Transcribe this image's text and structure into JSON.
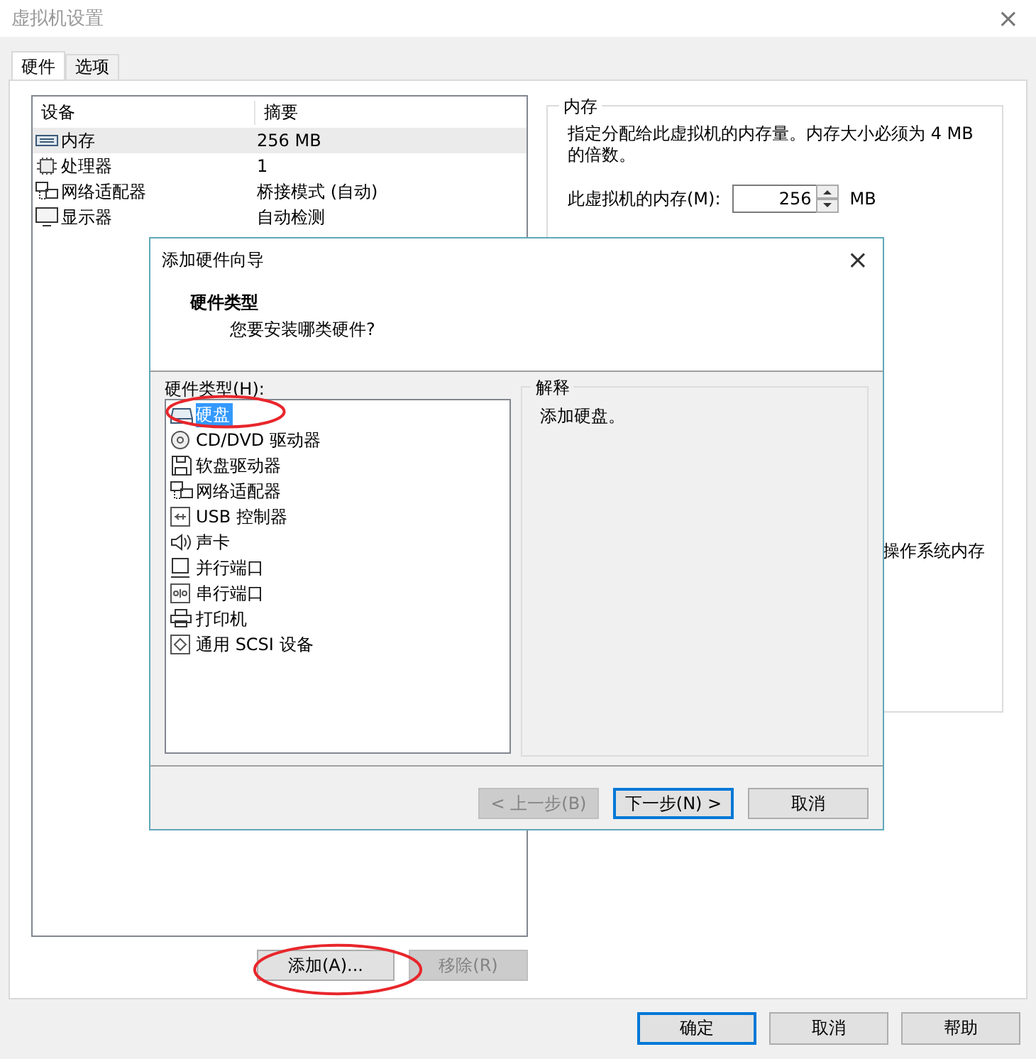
{
  "window": {
    "title": "虚拟机设置",
    "close": "×"
  },
  "tabs": [
    {
      "label": "硬件",
      "selected": true
    },
    {
      "label": "选项",
      "selected": false
    }
  ],
  "devices": {
    "columns": [
      "设备",
      "摘要"
    ],
    "rows": [
      {
        "kind": "memory",
        "name": "内存",
        "summary": "256 MB",
        "selected": true
      },
      {
        "kind": "cpu",
        "name": "处理器",
        "summary": "1",
        "selected": false
      },
      {
        "kind": "network",
        "name": "网络适配器",
        "summary": "桥接模式 (自动)",
        "selected": false
      },
      {
        "kind": "display",
        "name": "显示器",
        "summary": "自动检测",
        "selected": false
      }
    ]
  },
  "memory_panel": {
    "title": "内存",
    "description": "指定分配给此虚拟机的内存量。内存大小必须为 4 MB 的倍数。",
    "field_label": "此虚拟机的内存(M):",
    "value": "256",
    "unit": "MB",
    "partial_text": "操作系统内存"
  },
  "device_buttons": [
    {
      "label": "添加(A)...",
      "disabled": false
    },
    {
      "label": "移除(R)",
      "disabled": true
    }
  ],
  "footer_buttons": [
    {
      "label": "确定",
      "default": true
    },
    {
      "label": "取消",
      "default": false
    },
    {
      "label": "帮助",
      "default": false
    }
  ],
  "dialog": {
    "title": "添加硬件向导",
    "close": "×",
    "heading": "硬件类型",
    "subheading": "您要安装哪类硬件?",
    "list_label": "硬件类型(H):",
    "hardware_types": [
      {
        "kind": "disk",
        "label": "硬盘",
        "selected": true
      },
      {
        "kind": "cd",
        "label": "CD/DVD 驱动器",
        "selected": false
      },
      {
        "kind": "floppy",
        "label": "软盘驱动器",
        "selected": false
      },
      {
        "kind": "network",
        "label": "网络适配器",
        "selected": false
      },
      {
        "kind": "usb",
        "label": "USB 控制器",
        "selected": false
      },
      {
        "kind": "sound",
        "label": "声卡",
        "selected": false
      },
      {
        "kind": "parallel",
        "label": "并行端口",
        "selected": false
      },
      {
        "kind": "serial",
        "label": "串行端口",
        "selected": false
      },
      {
        "kind": "printer",
        "label": "打印机",
        "selected": false
      },
      {
        "kind": "scsi",
        "label": "通用 SCSI 设备",
        "selected": false
      }
    ],
    "explanation_title": "解释",
    "explanation": "添加硬盘。",
    "buttons": [
      {
        "label": "< 上一步(B)",
        "disabled": true,
        "default": false
      },
      {
        "label": "下一步(N) >",
        "disabled": false,
        "default": true
      },
      {
        "label": "取消",
        "disabled": false,
        "default": false
      }
    ]
  },
  "annotations": [
    {
      "color": "#e8262b"
    },
    {
      "color": "#e8262b"
    }
  ]
}
